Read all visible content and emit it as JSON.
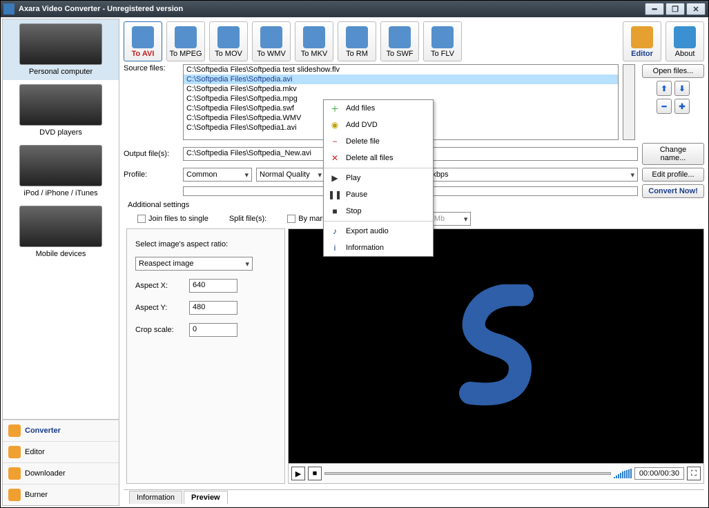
{
  "window": {
    "title": "Axara Video Converter - Unregistered version"
  },
  "devices": [
    {
      "label": "Personal computer",
      "selected": true
    },
    {
      "label": "DVD players",
      "selected": false
    },
    {
      "label": "iPod / iPhone / iTunes",
      "selected": false
    },
    {
      "label": "Mobile devices",
      "selected": false
    }
  ],
  "sidebar_nav": [
    {
      "label": "Converter",
      "active": true
    },
    {
      "label": "Editor",
      "active": false
    },
    {
      "label": "Downloader",
      "active": false
    },
    {
      "label": "Burner",
      "active": false
    }
  ],
  "toolbar": [
    {
      "label": "To AVI",
      "active": true
    },
    {
      "label": "To MPEG",
      "active": false
    },
    {
      "label": "To MOV",
      "active": false
    },
    {
      "label": "To WMV",
      "active": false
    },
    {
      "label": "To MKV",
      "active": false
    },
    {
      "label": "To RM",
      "active": false
    },
    {
      "label": "To SWF",
      "active": false
    },
    {
      "label": "To FLV",
      "active": false
    }
  ],
  "toolbar_right": {
    "editor_label": "Editor",
    "about_label": "About"
  },
  "labels": {
    "source_files": "Source files:",
    "output_files": "Output file(s):",
    "profile": "Profile:",
    "additional_settings": "Additional settings",
    "join_files": "Join files to single",
    "split_files": "Split file(s):",
    "by_markers": "By markers",
    "by_size": "By size:",
    "select_aspect": "Select image's aspect ratio:",
    "aspect_x": "Aspect X:",
    "aspect_y": "Aspect Y:",
    "crop_scale": "Crop scale:"
  },
  "source_files": [
    {
      "path": "C:\\Softpedia Files\\Softpedia test slideshow.flv",
      "selected": false
    },
    {
      "path": "C:\\Softpedia Files\\Softpedia.avi",
      "selected": true
    },
    {
      "path": "C:\\Softpedia Files\\Softpedia.mkv",
      "selected": false
    },
    {
      "path": "C:\\Softpedia Files\\Softpedia.mpg",
      "selected": false
    },
    {
      "path": "C:\\Softpedia Files\\Softpedia.swf",
      "selected": false
    },
    {
      "path": "C:\\Softpedia Files\\Softpedia.WMV",
      "selected": false
    },
    {
      "path": "C:\\Softpedia Files\\Softpedia1.avi",
      "selected": false
    }
  ],
  "output_file": "C:\\Softpedia Files\\Softpedia_New.avi",
  "profile": {
    "preset": "Common",
    "quality": "Normal Quality",
    "detail": "1200 kbps; Audio: MP3 - 128 kbps"
  },
  "split_size": "690 Mb",
  "aspect": {
    "mode": "Reaspect image",
    "x": "640",
    "y": "480",
    "crop": "0"
  },
  "buttons": {
    "open_files": "Open files...",
    "change_name": "Change name...",
    "edit_profile": "Edit profile...",
    "convert_now": "Convert Now!"
  },
  "preview": {
    "time": "00:00/00:30"
  },
  "tabs": [
    {
      "label": "Information",
      "active": false
    },
    {
      "label": "Preview",
      "active": true
    }
  ],
  "context_menu": [
    {
      "icon": "＋",
      "color": "#2a9b2a",
      "label": "Add files"
    },
    {
      "icon": "◉",
      "color": "#c0a000",
      "label": "Add DVD"
    },
    {
      "icon": "−",
      "color": "#c02020",
      "label": "Delete file"
    },
    {
      "icon": "✕",
      "color": "#c02020",
      "label": "Delete all files"
    },
    {
      "sep": true
    },
    {
      "icon": "▶",
      "color": "#333",
      "label": "Play"
    },
    {
      "icon": "❚❚",
      "color": "#333",
      "label": "Pause"
    },
    {
      "icon": "■",
      "color": "#333",
      "label": "Stop"
    },
    {
      "sep": true
    },
    {
      "icon": "♪",
      "color": "#1a3c8a",
      "label": "Export audio"
    },
    {
      "icon": "i",
      "color": "#1a3c8a",
      "label": "Information"
    }
  ]
}
